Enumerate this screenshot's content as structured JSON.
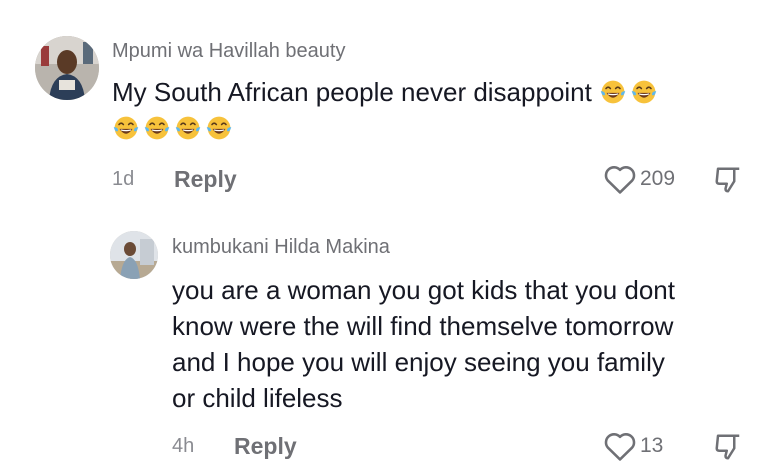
{
  "comments": [
    {
      "username": "Mpumi wa Havillah beauty",
      "text": "My South African people never disappoint",
      "emoji_icon": "face-with-tears-of-joy-icon",
      "emoji_count_line1": 2,
      "emoji_count_line2": 4,
      "time": "1d",
      "reply_label": "Reply",
      "likes": "209"
    },
    {
      "username": "kumbukani Hilda Makina",
      "text_lines": [
        "you are a woman you got kids that you dont",
        "know were the will find themselve tomorrow",
        "and I hope you will enjoy seeing you family",
        "or child lifeless"
      ],
      "time": "4h",
      "reply_label": "Reply",
      "likes": "13"
    }
  ],
  "colors": {
    "text": "#161823",
    "secondary": "#6f7075",
    "emoji_face": "#f7c23b"
  }
}
